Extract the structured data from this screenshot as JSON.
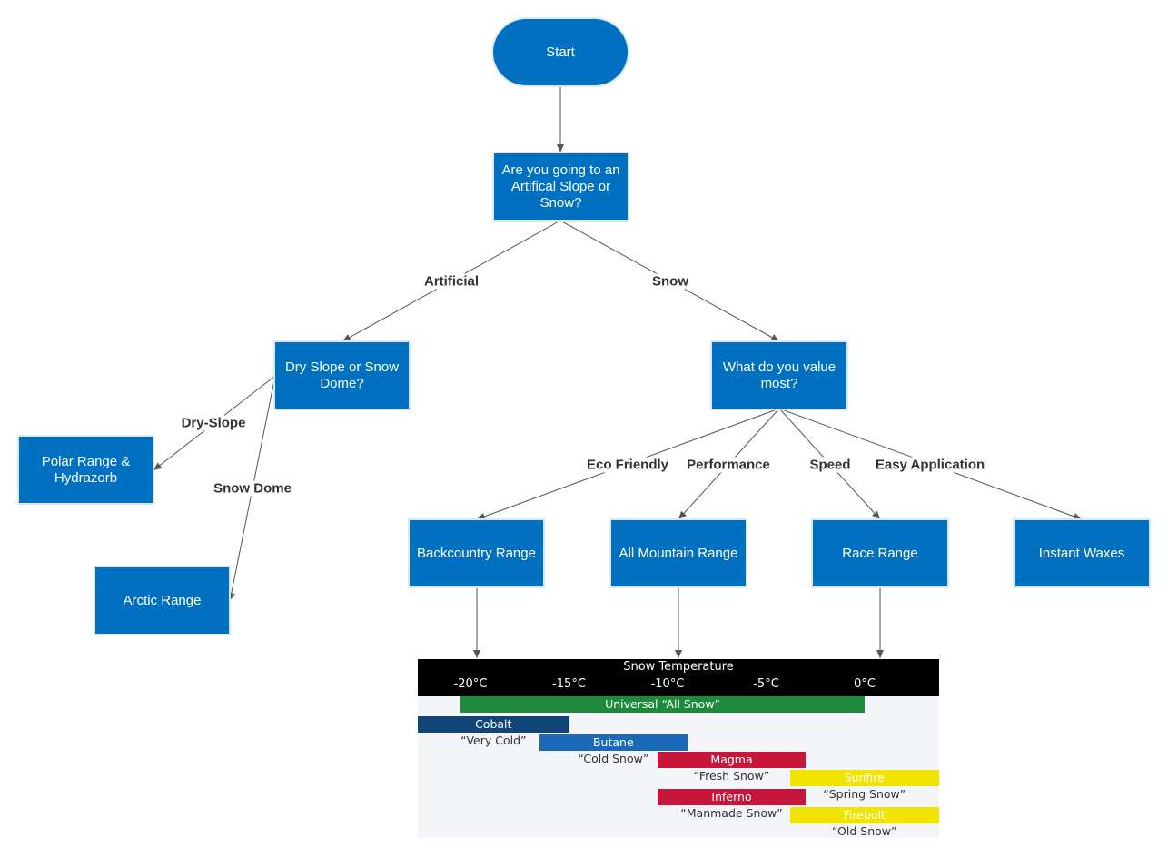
{
  "nodes": {
    "start": "Start",
    "q_slope": "Are you going to an Artifical Slope or Snow?",
    "q_dry": "Dry Slope or Snow Dome?",
    "q_value": "What do you value most?",
    "polar": "Polar Range & Hydrazorb",
    "arctic": "Arctic Range",
    "backcountry": "Backcountry Range",
    "all_mountain": "All Mountain Range",
    "race": "Race Range",
    "instant": "Instant Waxes"
  },
  "edge_labels": {
    "artificial": "Artificial",
    "snow": "Snow",
    "dry_slope": "Dry-Slope",
    "snow_dome": "Snow Dome",
    "eco": "Eco Friendly",
    "performance": "Performance",
    "speed": "Speed",
    "easy": "Easy Application"
  },
  "colors": {
    "node": "#0070c0",
    "edge": "#555555"
  },
  "chart_data": {
    "type": "range-bar",
    "title": "Snow Temperature",
    "ticks": [
      "-20°C",
      "-15°C",
      "-10°C",
      "-5°C",
      "0°C"
    ],
    "tick_values": [
      -20,
      -15,
      -10,
      -5,
      0
    ],
    "bars": [
      {
        "name": "Universal “All Snow”",
        "desc": "",
        "from": -20.5,
        "to": 0,
        "color": "#1e8a3c"
      },
      {
        "name": "Cobalt",
        "desc": "“Very Cold”",
        "from": -23,
        "to": -15,
        "color": "#114477"
      },
      {
        "name": "Butane",
        "desc": "“Cold Snow”",
        "from": -16.5,
        "to": -9,
        "color": "#1a6ab8"
      },
      {
        "name": "Magma",
        "desc": "“Fresh Snow”",
        "from": -10.5,
        "to": -3,
        "color": "#c8163a"
      },
      {
        "name": "Sunfire",
        "desc": "“Spring Snow”",
        "from": -3.8,
        "to": 3.8,
        "color": "#f0e400"
      },
      {
        "name": "Inferno",
        "desc": "“Manmade Snow”",
        "from": -10.5,
        "to": -3,
        "color": "#c8163a"
      },
      {
        "name": "Firebolt",
        "desc": "“Old Snow”",
        "from": -3.8,
        "to": 3.8,
        "color": "#f0e400"
      }
    ]
  }
}
